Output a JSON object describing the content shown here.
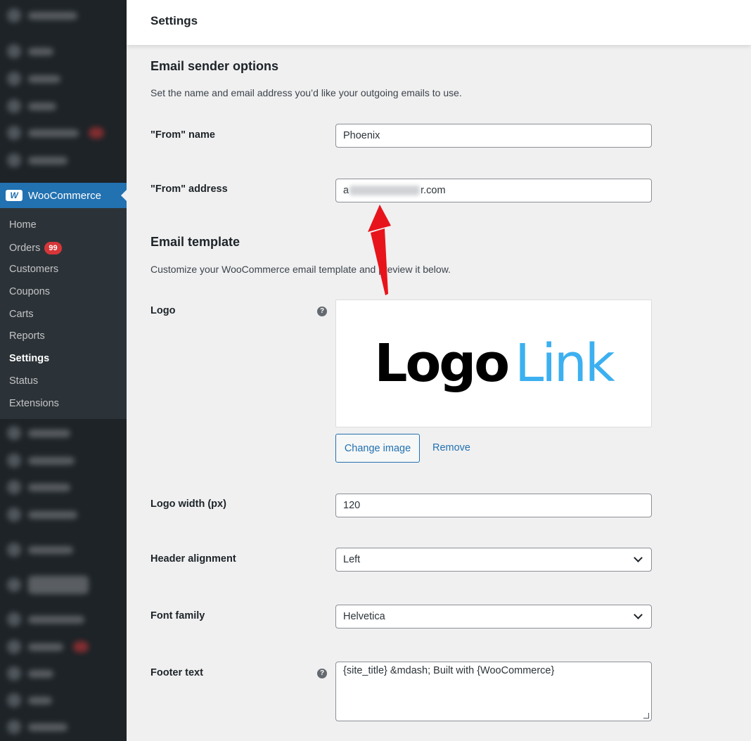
{
  "sidebar": {
    "woocommerce_label": "WooCommerce",
    "submenu": [
      {
        "label": "Home"
      },
      {
        "label": "Orders",
        "badge": "99"
      },
      {
        "label": "Customers"
      },
      {
        "label": "Coupons"
      },
      {
        "label": "Carts"
      },
      {
        "label": "Reports"
      },
      {
        "label": "Settings",
        "active": true
      },
      {
        "label": "Status"
      },
      {
        "label": "Extensions"
      }
    ]
  },
  "header": {
    "title": "Settings"
  },
  "email_sender": {
    "title": "Email sender options",
    "description": "Set the name and email address you’d like your outgoing emails to use.",
    "from_name_label": "\"From\" name",
    "from_name_value": "Phoenix",
    "from_address_label": "\"From\" address",
    "from_address_prefix": "a",
    "from_address_suffix": "r.com"
  },
  "email_template": {
    "title": "Email template",
    "description": "Customize your WooCommerce email template and preview it below.",
    "logo_label": "Logo",
    "logo_text_black": "Logo",
    "logo_text_blue": "Link",
    "change_image_label": "Change image",
    "remove_label": "Remove",
    "logo_width_label": "Logo width (px)",
    "logo_width_value": "120",
    "header_alignment_label": "Header alignment",
    "header_alignment_value": "Left",
    "font_family_label": "Font family",
    "font_family_value": "Helvetica",
    "footer_text_label": "Footer text",
    "footer_text_value": "{site_title} &mdash; Built with {WooCommerce}",
    "help_glyph": "?"
  },
  "colors": {
    "sidebar_bg": "#1d2327",
    "submenu_bg": "#2c3338",
    "accent": "#2271b1",
    "badge": "#d63638",
    "annotation_arrow": "#e8141b",
    "logo_blue": "#3cb0f0"
  }
}
